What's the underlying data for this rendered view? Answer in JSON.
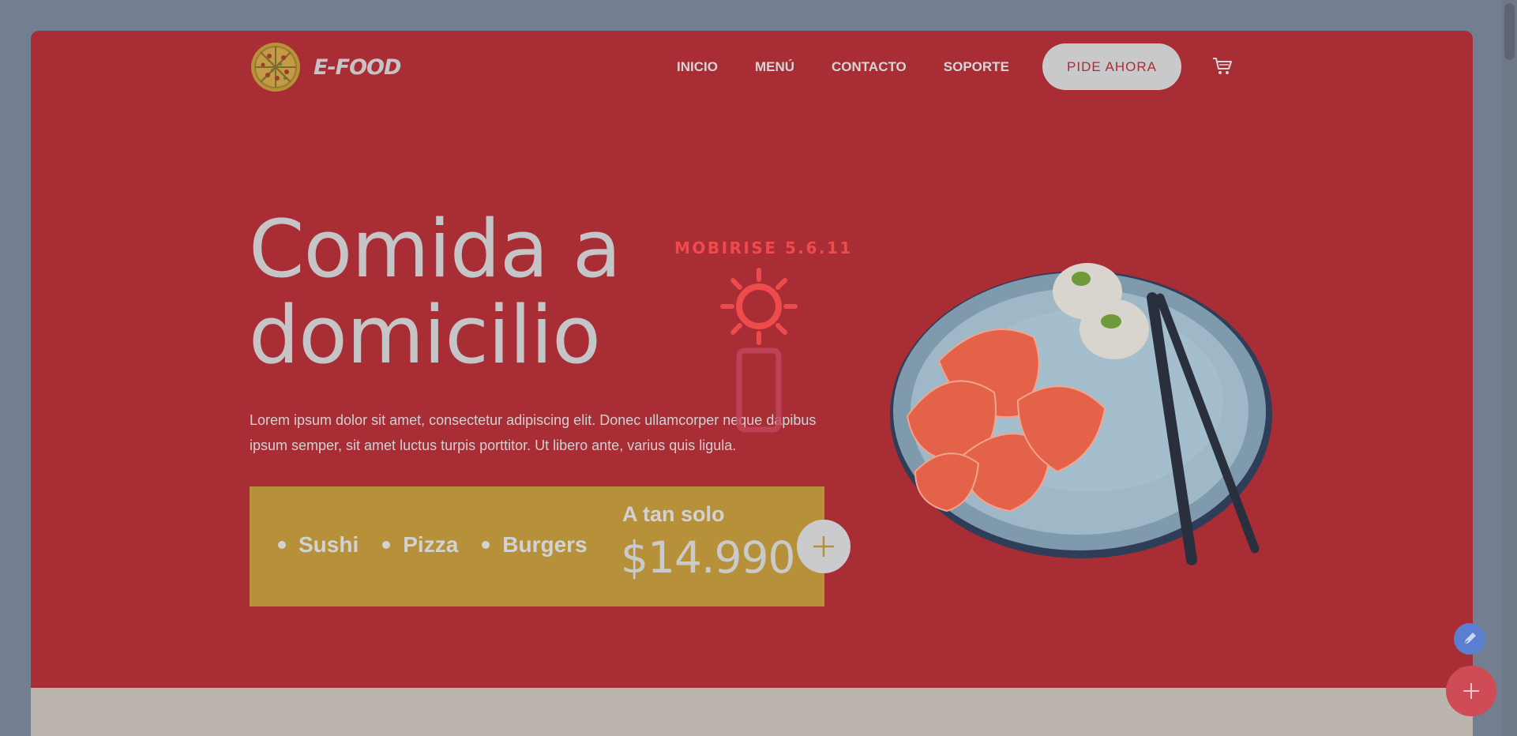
{
  "brand": {
    "name": "E-FOOD",
    "logo_icon": "pizza-icon"
  },
  "nav": {
    "items": [
      {
        "label": "INICIO"
      },
      {
        "label": "MENÚ"
      },
      {
        "label": "CONTACTO"
      },
      {
        "label": "SOPORTE"
      }
    ],
    "cta_label": "PIDE AHORA",
    "cart_icon": "cart-icon"
  },
  "hero": {
    "title_line1": "Comida a",
    "title_line2": "domicilio",
    "lead": "Lorem ipsum dolor sit amet, consectetur adipiscing elit. Donec ullamcorper neque dapibus ipsum semper, sit amet luctus turpis porttitor. Ut libero ante, varius quis ligula.",
    "promo": {
      "items": [
        "Sushi",
        "Pizza",
        "Burgers"
      ],
      "label": "A tan solo",
      "price": "$14.990"
    }
  },
  "watermark": {
    "label": "MOBIRISE  5.6.11"
  },
  "colors": {
    "hero_bg": "#a92d35",
    "promo_bg": "#b7913a",
    "accent": "#ef4a4c",
    "page_bg": "#737e90"
  }
}
